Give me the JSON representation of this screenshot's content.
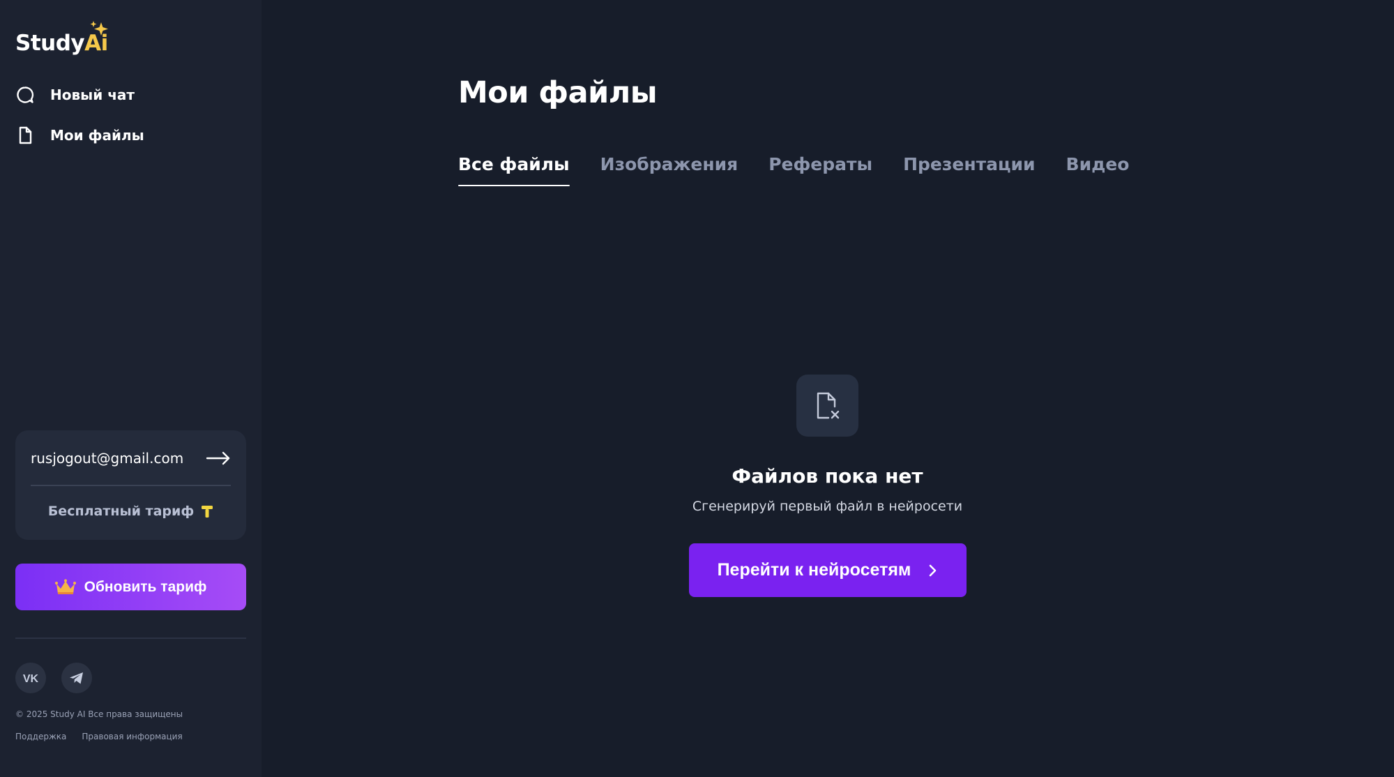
{
  "brand": {
    "logo_part1": "Study",
    "logo_part2": "Ai",
    "accent_color": "#7a22f0",
    "logo_accent_color": "#f5c84a"
  },
  "sidebar": {
    "nav": [
      {
        "label": "Новый чат",
        "icon": "chat-bubble-icon"
      },
      {
        "label": "Мои файлы",
        "icon": "file-icon"
      }
    ],
    "account": {
      "email": "rusjogout@gmail.com",
      "logout_icon": "arrow-right-icon",
      "plan_label": "Бесплатный тариф",
      "plan_icon": "tier-badge-icon"
    },
    "upgrade_button": {
      "label": "Обновить тариф",
      "icon": "crown-icon"
    },
    "socials": [
      {
        "name": "vk",
        "icon": "vk-icon"
      },
      {
        "name": "telegram",
        "icon": "telegram-icon"
      }
    ],
    "copyright": "© 2025 Study AI Все права защищены",
    "footer_links": [
      "Поддержка",
      "Правовая информация"
    ]
  },
  "main": {
    "title": "Мои файлы",
    "tabs": [
      {
        "label": "Все файлы",
        "active": true
      },
      {
        "label": "Изображения",
        "active": false
      },
      {
        "label": "Рефераты",
        "active": false
      },
      {
        "label": "Презентации",
        "active": false
      },
      {
        "label": "Видео",
        "active": false
      }
    ],
    "empty_state": {
      "icon": "file-x-icon",
      "title": "Файлов пока нет",
      "subtitle": "Сгенерируй первый файл в нейросети",
      "button_label": "Перейти к нейросетям",
      "button_icon": "chevron-right-icon"
    }
  }
}
